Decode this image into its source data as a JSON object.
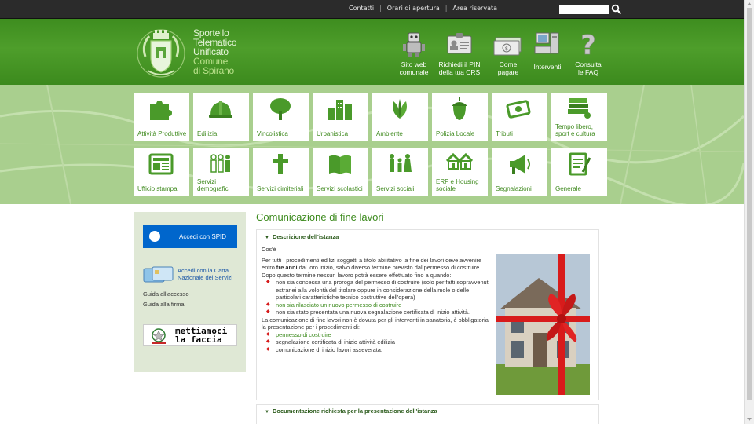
{
  "topbar": {
    "links": [
      "Contatti",
      "Orari di apertura",
      "Area riservata"
    ],
    "separator": "|",
    "search_value": "",
    "search_icon": "magnifier-icon"
  },
  "brand": {
    "line1": "Sportello",
    "line2": "Telematico",
    "line3": "Unificato",
    "line4": "Comune",
    "line5": "di Spirano",
    "logo_icon": "municipal-crest-icon"
  },
  "header_links": [
    {
      "label1": "Sito web",
      "label2": "comunale",
      "icon": "robot-icon"
    },
    {
      "label1": "Richiedi il PIN",
      "label2": "della tua CRS",
      "icon": "id-badge-icon"
    },
    {
      "label1": "Come",
      "label2": "pagare",
      "icon": "banknotes-icon"
    },
    {
      "label1": "Interventi",
      "label2": "",
      "icon": "computer-icon"
    },
    {
      "label1": "Consulta",
      "label2": "le FAQ",
      "icon": "question-mark-icon"
    }
  ],
  "tiles": [
    {
      "label": "Attività Produttive",
      "icon": "puzzle-icon"
    },
    {
      "label": "Edilizia",
      "icon": "hardhat-icon"
    },
    {
      "label": "Vincolistica",
      "icon": "tree-icon"
    },
    {
      "label": "Urbanistica",
      "icon": "buildings-icon"
    },
    {
      "label": "Ambiente",
      "icon": "leaves-icon"
    },
    {
      "label": "Polizia Locale",
      "icon": "acorn-icon"
    },
    {
      "label": "Tributi",
      "icon": "money-icon"
    },
    {
      "label": "Tempo libero, sport e cultura",
      "icon": "books-icon"
    },
    {
      "label": "Ufficio stampa",
      "icon": "newspaper-icon"
    },
    {
      "label": "Servizi demografici",
      "icon": "people-icon"
    },
    {
      "label": "Servizi cimiteriali",
      "icon": "cross-icon"
    },
    {
      "label": "Servizi scolastici",
      "icon": "open-book-icon"
    },
    {
      "label": "Servizi sociali",
      "icon": "family-icon"
    },
    {
      "label": "ERP e Housing sociale",
      "icon": "houses-icon"
    },
    {
      "label": "Segnalazioni",
      "icon": "megaphone-icon"
    },
    {
      "label": "Generale",
      "icon": "notepad-icon"
    }
  ],
  "sidebar": {
    "spid_label": "Accedi con SPID",
    "crs_label1": "Accedi con la Carta",
    "crs_label2": "Nazionale dei Servizi",
    "guide_access": "Guida all'accesso",
    "guide_sign": "Guida alla firma",
    "banner_line1": "mettiamoci",
    "banner_line2": "la faccia"
  },
  "content": {
    "title": "Comunicazione di fine lavori",
    "section1_title": "Descrizione dell'istanza",
    "section2_title": "Documentazione richiesta per la presentazione dell'istanza",
    "intro_label": "Cos'è",
    "para1_a": "Per tutti i procedimenti edilizi soggetti a titolo abilitativo la fine dei lavori deve avvenire entro ",
    "para1_bold": "tre anni",
    "para1_b": " dal loro inizio, salvo diverso termine previsto dal permesso di costruire.",
    "para2": "Dopo questo termine nessun lavoro potrà essere effettuato fino a quando:",
    "bullets1": [
      "non sia concessa una proroga del permesso di costruire (solo per fatti sopravvenuti estranei alla volontà del titolare oppure in considerazione della mole o delle particolari caratteristiche tecnico costruttive dell'opera)",
      "non sia rilasciato un nuovo permesso di costruire",
      "non sia stato presentata una nuova segnalazione certificata di inizio attività."
    ],
    "para3": "La comunicazione di fine lavori non è dovuta per gli interventi in sanatoria, è obbligatoria la presentazione per i procedimenti di:",
    "bullets2": [
      "permesso di costruire",
      "segnalazione certificata di inizio attività edilizia",
      "comunicazione di inizio lavori asseverata."
    ]
  },
  "colors": {
    "brand_green": "#3c8a1d",
    "header_green": "#4e9e2b",
    "band_green": "#a9cf8e",
    "spid_blue": "#0066cc",
    "bullet_red": "#d61a1a"
  }
}
